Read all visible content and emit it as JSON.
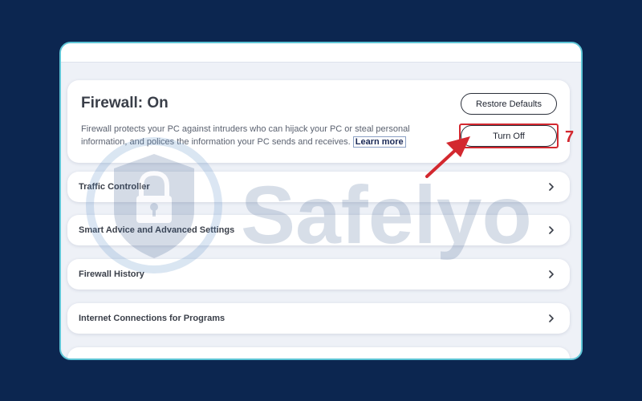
{
  "firewall": {
    "title": "Firewall: On",
    "description": "Firewall protects your PC against intruders who can hijack your PC or steal personal information, and polices the information your PC sends and receives.",
    "learn_more": "Learn more",
    "restore_defaults_label": "Restore Defaults",
    "turn_off_label": "Turn Off"
  },
  "settings_rows": [
    {
      "label": "Traffic Controller"
    },
    {
      "label": "Smart Advice and Advanced Settings"
    },
    {
      "label": "Firewall History"
    },
    {
      "label": "Internet Connections for Programs"
    },
    {
      "label": ""
    }
  ],
  "annotation": {
    "step_number": "7",
    "color": "#d3282f"
  },
  "watermark": {
    "text": "Safelyo",
    "icon": "shield-lock-icon"
  },
  "colors": {
    "background": "#0c2650",
    "window_border": "#5ec5d6",
    "text_primary": "#3a3f49"
  }
}
